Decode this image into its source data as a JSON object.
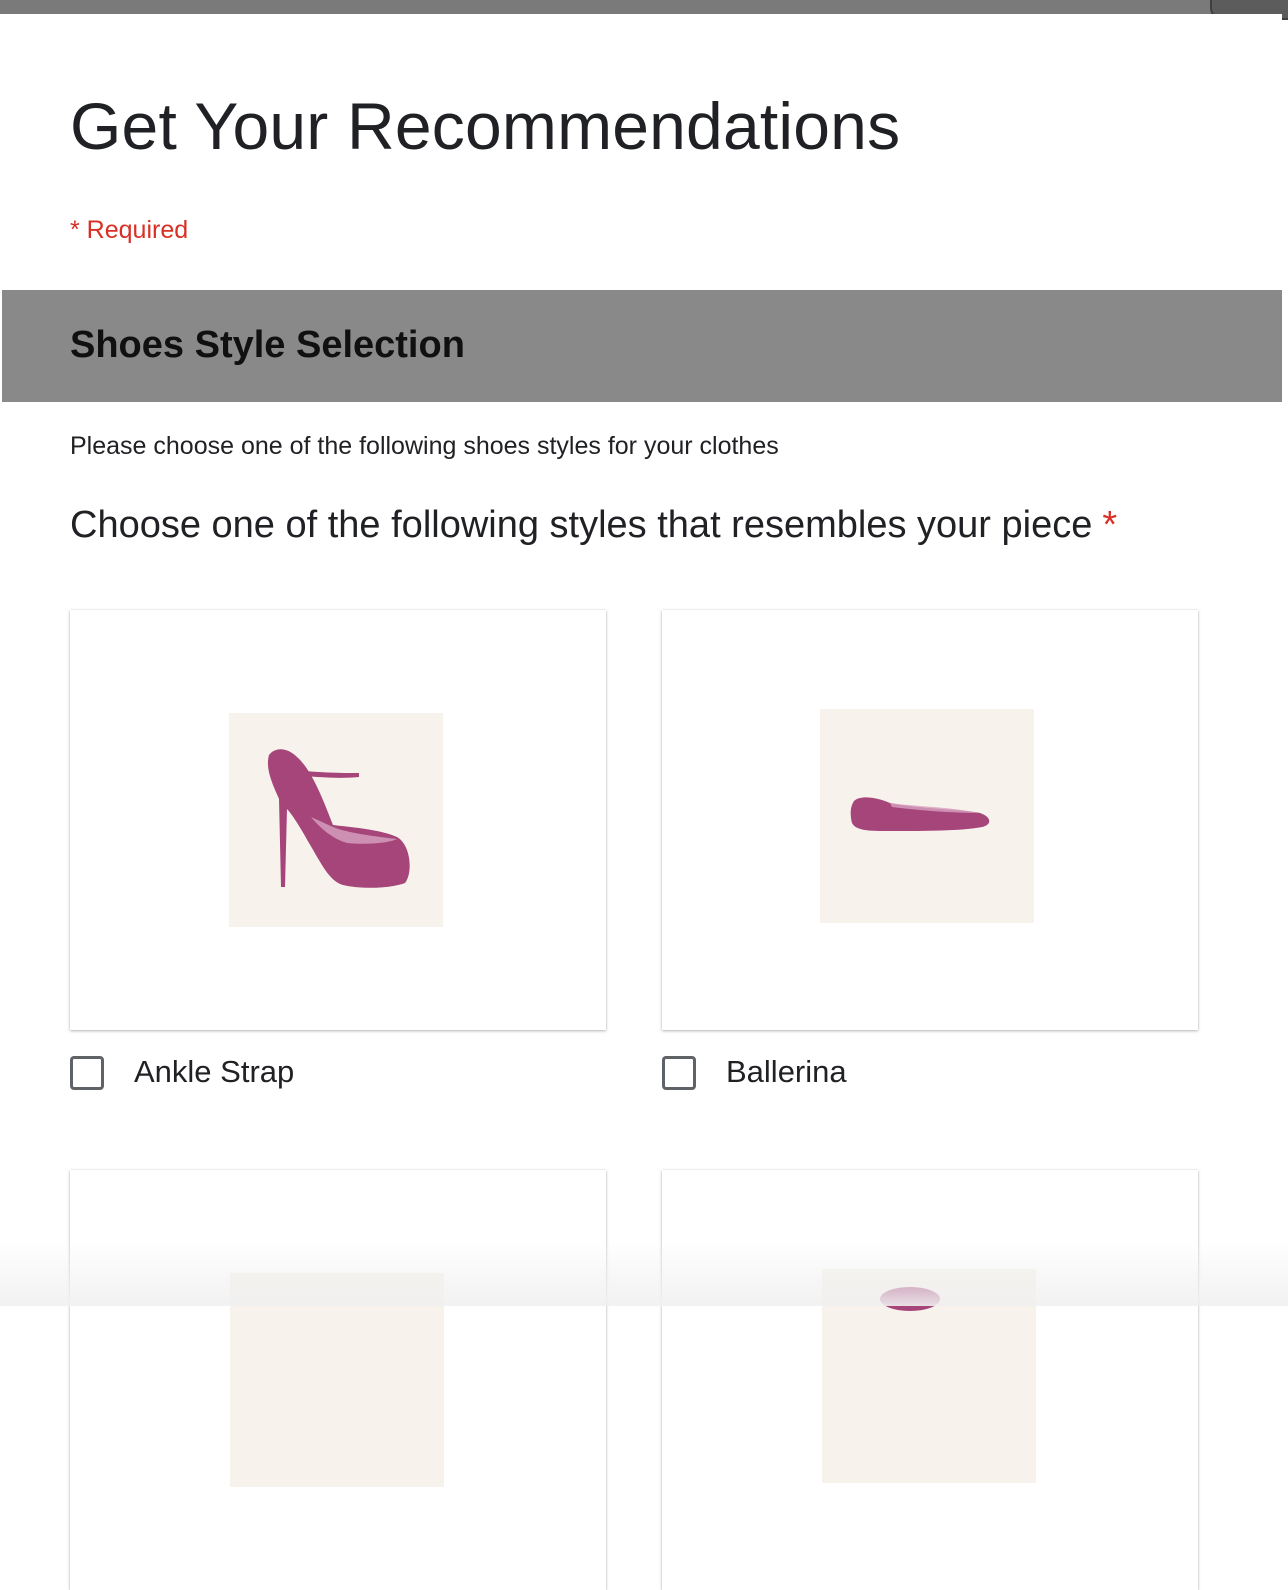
{
  "form": {
    "title": "Get Your Recommendations",
    "required_note": "* Required"
  },
  "section": {
    "title": "Shoes Style Selection",
    "description": "Please choose one of the following shoes styles for your clothes"
  },
  "question": {
    "title": "Choose one of the following styles that resembles your piece",
    "required_marker": "*"
  },
  "options": [
    {
      "label": "Ankle Strap",
      "checked": false,
      "icon": "ankle-strap-shoe-image"
    },
    {
      "label": "Ballerina",
      "checked": false,
      "icon": "ballerina-shoe-image"
    },
    {
      "label": "",
      "checked": false,
      "icon": "shoe-image"
    },
    {
      "label": "",
      "checked": false,
      "icon": "shoe-image"
    }
  ],
  "colors": {
    "accent_required": "#d93025",
    "section_header_bg": "#898989",
    "shoe_color": "#a6457a",
    "tile_bg": "#f7f3ec"
  }
}
